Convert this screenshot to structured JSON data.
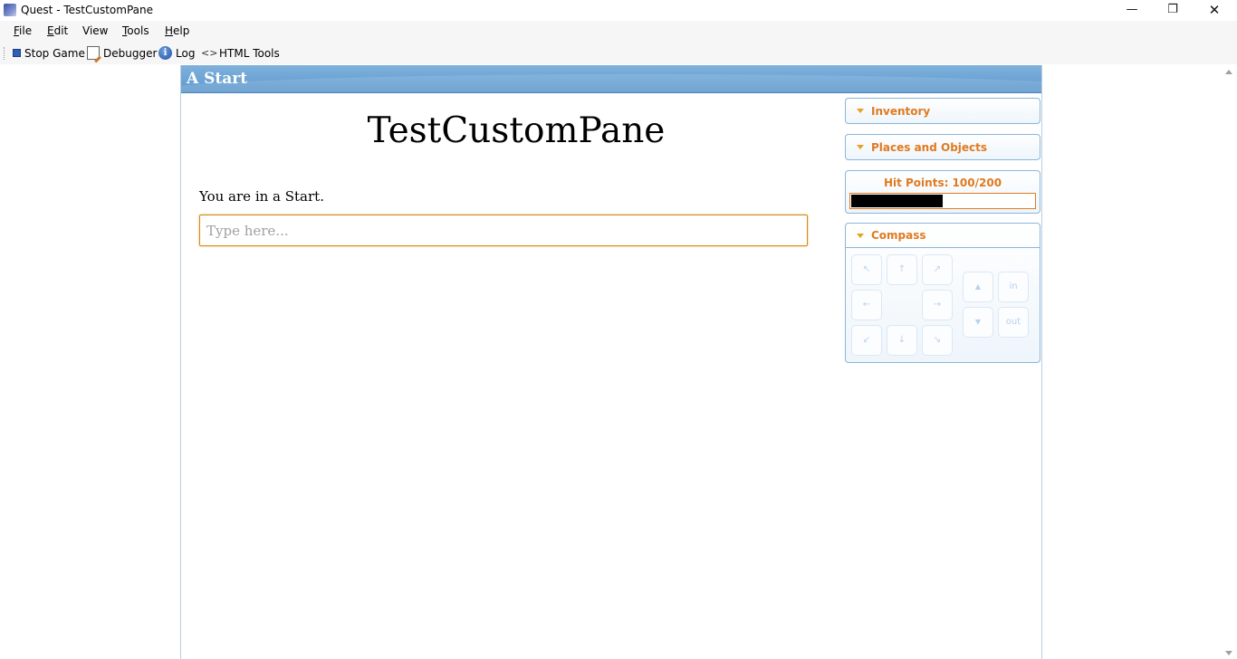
{
  "window": {
    "title": "Quest - TestCustomPane",
    "minimize_glyph": "—",
    "maximize_glyph": "❐",
    "close_glyph": "✕"
  },
  "menu": {
    "file": {
      "underline": "F",
      "rest": "ile"
    },
    "edit": {
      "underline": "E",
      "rest": "dit"
    },
    "view": {
      "underline": "",
      "rest": "View"
    },
    "tools": {
      "underline": "T",
      "rest": "ools"
    },
    "help": {
      "underline": "H",
      "rest": "elp"
    }
  },
  "toolbar": {
    "stop_game": "Stop Game",
    "debugger": "Debugger",
    "log": "Log",
    "html_tools": "HTML Tools"
  },
  "game": {
    "location": "A Start",
    "title": "TestCustomPane",
    "room_description": "You are in a Start.",
    "command_placeholder": "Type here..."
  },
  "panes": {
    "inventory": "Inventory",
    "places": "Places and Objects",
    "hit_points_label": "Hit Points: 100/200",
    "hit_points_fraction": 0.5,
    "compass": "Compass"
  },
  "compass": {
    "nw": "↖",
    "n": "↑",
    "ne": "↗",
    "w": "←",
    "e": "→",
    "sw": "↙",
    "s": "↓",
    "se": "↘",
    "up": "▲",
    "down": "▼",
    "in": "in",
    "out": "out"
  },
  "colors": {
    "accent_orange": "#e07a1f",
    "location_bar_blue": "#6fa6d6",
    "pane_border": "#8ab6dc"
  }
}
